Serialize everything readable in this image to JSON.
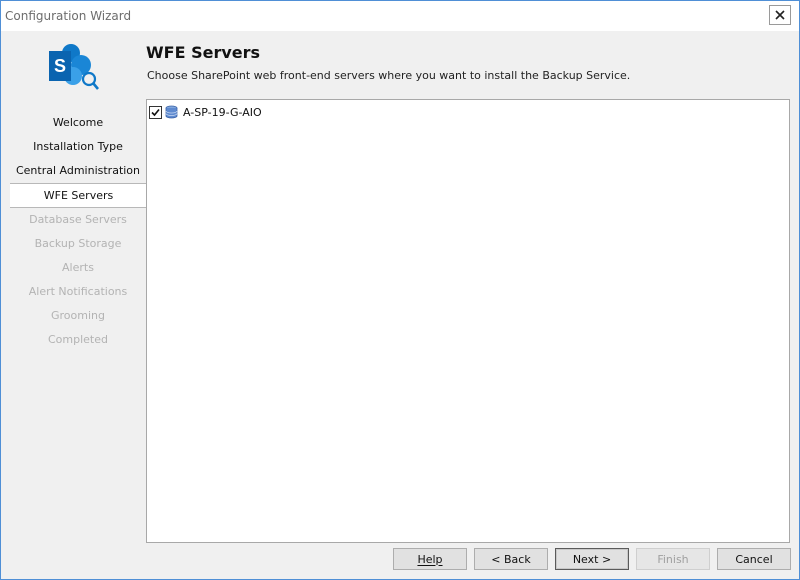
{
  "window": {
    "title": "Configuration Wizard",
    "close_icon": "close-icon"
  },
  "logo": {
    "icon": "sharepoint-logo-icon",
    "letter": "S",
    "color": "#0f78c8"
  },
  "nav": {
    "items": [
      {
        "label": "Welcome",
        "state": "done"
      },
      {
        "label": "Installation Type",
        "state": "done"
      },
      {
        "label": "Central Administration",
        "state": "done"
      },
      {
        "label": "WFE Servers",
        "state": "active"
      },
      {
        "label": "Database Servers",
        "state": "disabled"
      },
      {
        "label": "Backup Storage",
        "state": "disabled"
      },
      {
        "label": "Alerts",
        "state": "disabled"
      },
      {
        "label": "Alert Notifications",
        "state": "disabled"
      },
      {
        "label": "Grooming",
        "state": "disabled"
      },
      {
        "label": "Completed",
        "state": "disabled"
      }
    ]
  },
  "page": {
    "title": "WFE Servers",
    "subtitle": "Choose SharePoint web front-end servers where you want to install the Backup Service."
  },
  "servers": [
    {
      "name": "A-SP-19-G-AIO",
      "checked": true,
      "icon": "database-server-icon"
    }
  ],
  "buttons": {
    "help": {
      "label": "Help",
      "mnemonic": "H",
      "enabled": true
    },
    "back": {
      "label": "< Back",
      "mnemonic": "B",
      "enabled": true
    },
    "next": {
      "label": "Next >",
      "mnemonic": "N",
      "enabled": true
    },
    "finish": {
      "label": "Finish",
      "mnemonic": "F",
      "enabled": false
    },
    "cancel": {
      "label": "Cancel",
      "mnemonic": "C",
      "enabled": true
    }
  }
}
